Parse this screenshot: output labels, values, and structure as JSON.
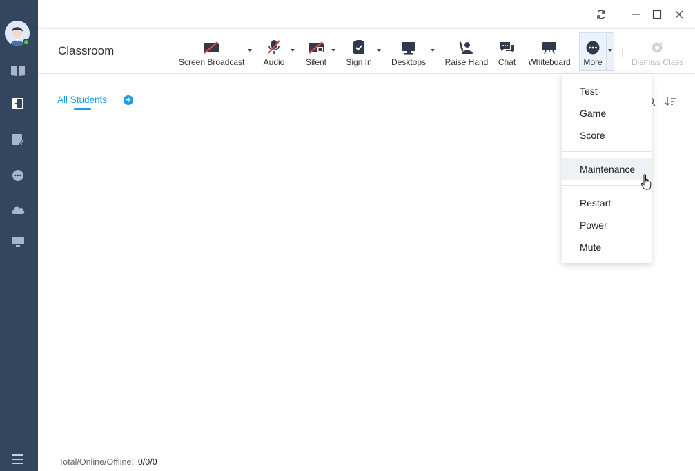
{
  "page_title": "Classroom",
  "toolbar": {
    "items": [
      {
        "label": "Screen Broadcast",
        "icon": "screen-broadcast-icon"
      },
      {
        "label": "Audio",
        "icon": "audio-muted-icon"
      },
      {
        "label": "Silent",
        "icon": "silent-lock-icon"
      },
      {
        "label": "Sign In",
        "icon": "sign-in-clipboard-icon"
      },
      {
        "label": "Desktops",
        "icon": "desktops-monitor-icon"
      },
      {
        "label": "Raise Hand",
        "icon": "raise-hand-icon"
      },
      {
        "label": "Chat",
        "icon": "chat-bubbles-icon"
      },
      {
        "label": "Whiteboard",
        "icon": "whiteboard-icon"
      },
      {
        "label": "More",
        "icon": "more-ellipsis-icon"
      },
      {
        "label": "Dismiss Class",
        "icon": "dismiss-class-icon",
        "disabled": true
      }
    ]
  },
  "tabs": {
    "all_students": "All Students"
  },
  "footer": {
    "label": "Total/Online/Offline:",
    "counts": "0/0/0"
  },
  "more_menu": {
    "group1": [
      "Test",
      "Game",
      "Score"
    ],
    "group2": [
      "Maintenance"
    ],
    "group3": [
      "Restart",
      "Power",
      "Mute"
    ],
    "hovered": "Maintenance"
  },
  "colors": {
    "sidebar": "#34465e",
    "accent": "#1e9be8",
    "icon_red": "#e04848",
    "icon_dark": "#2f3b4c",
    "online": "#2bd15f"
  }
}
